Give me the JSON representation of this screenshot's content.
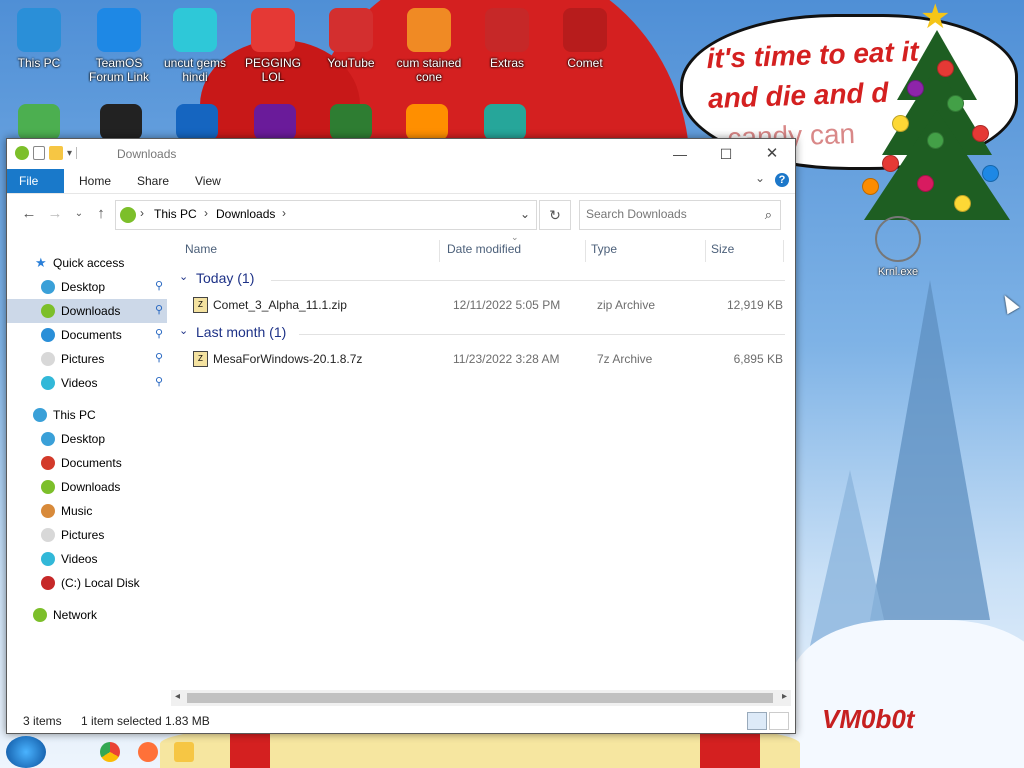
{
  "desktop": {
    "icons": [
      {
        "label": "This PC",
        "icon": "this-pc-icon",
        "color": "#2a8fd8"
      },
      {
        "label": "TeamOS Forum Link",
        "icon": "gear-icon",
        "color": "#1e88e5"
      },
      {
        "label": "uncut gems hindi",
        "icon": "diamond-icon",
        "color": "#2ec8d8"
      },
      {
        "label": "PEGGING LOL",
        "icon": "p-logo-icon",
        "color": "#e53935"
      },
      {
        "label": "YouTube",
        "icon": "angry-bird-icon",
        "color": "#d32f2f"
      },
      {
        "label": "cum stained cone",
        "icon": "cone-icon",
        "color": "#f08a24"
      },
      {
        "label": "Extras",
        "icon": "extras-icon",
        "color": "#c62828"
      },
      {
        "label": "Comet",
        "icon": "comet-icon",
        "color": "#b71c1c"
      }
    ],
    "krnl": {
      "label": "Krnl.exe"
    },
    "speech_bubble": {
      "line1": "it's time to eat it",
      "line2": "and die and d",
      "line3": "candy can"
    },
    "watermark": "VM0b0t"
  },
  "window": {
    "title": "Downloads",
    "ribbon_tabs": [
      "File",
      "Home",
      "Share",
      "View"
    ],
    "address": {
      "crumb1": "This PC",
      "crumb2": "Downloads"
    },
    "search_placeholder": "Search Downloads",
    "nav": {
      "quick_access": "Quick access",
      "quick_items": [
        {
          "label": "Desktop",
          "color": "#3aa0d8"
        },
        {
          "label": "Downloads",
          "color": "#7cbf2a"
        },
        {
          "label": "Documents",
          "color": "#2a8fd8"
        },
        {
          "label": "Pictures",
          "color": "#d8d8d8"
        },
        {
          "label": "Videos",
          "color": "#32b8d8"
        }
      ],
      "this_pc": "This PC",
      "pc_items": [
        {
          "label": "Desktop",
          "color": "#3aa0d8"
        },
        {
          "label": "Documents",
          "color": "#d33a2a"
        },
        {
          "label": "Downloads",
          "color": "#7cbf2a"
        },
        {
          "label": "Music",
          "color": "#d88a3a"
        },
        {
          "label": "Pictures",
          "color": "#d8d8d8"
        },
        {
          "label": "Videos",
          "color": "#32b8d8"
        },
        {
          "label": "(C:) Local Disk",
          "color": "#c62828"
        }
      ],
      "network": "Network"
    },
    "columns": {
      "name": "Name",
      "date": "Date modified",
      "type": "Type",
      "size": "Size"
    },
    "groups": [
      {
        "title": "Today (1)",
        "files": [
          {
            "name": "Comet_3_Alpha_11.1.zip",
            "date": "12/11/2022 5:05 PM",
            "type": "zip Archive",
            "size": "12,919 KB"
          }
        ]
      },
      {
        "title": "Last month (1)",
        "files": [
          {
            "name": "MesaForWindows-20.1.8.7z",
            "date": "11/23/2022 3:28 AM",
            "type": "7z Archive",
            "size": "6,895 KB"
          }
        ]
      }
    ],
    "status": {
      "items": "3 items",
      "selected": "1 item selected  1.83 MB"
    }
  },
  "colors": {
    "accent": "#1979ca",
    "selection": "#ccd8e8",
    "group_title": "#1e3287"
  }
}
